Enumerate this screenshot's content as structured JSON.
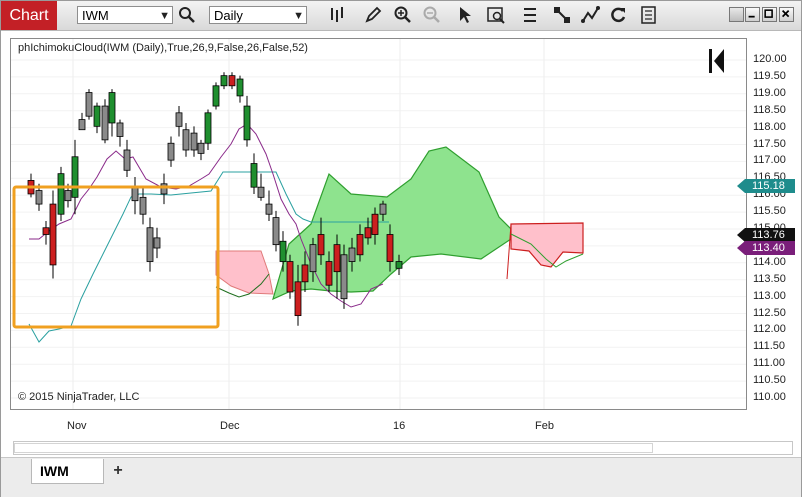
{
  "window": {
    "title": "Chart",
    "instrument": "IWM",
    "interval": "Daily"
  },
  "toolbar": {
    "icons": [
      "search-icon",
      "bar-type-icon",
      "pencil-icon",
      "zoom-in-icon",
      "zoom-out-icon",
      "pointer-icon",
      "data-box-icon",
      "properties-icon",
      "strategy-icon",
      "indicators-icon",
      "reload-icon",
      "template-icon"
    ]
  },
  "chart": {
    "indicator_label": "phIchimokuCloud(IWM (Daily),True,26,9,False,26,False,52)",
    "copyright": "© 2015 NinjaTrader, LLC",
    "y_ticks": [
      "120.00",
      "119.50",
      "119.00",
      "118.50",
      "118.00",
      "117.50",
      "117.00",
      "116.50",
      "116.00",
      "115.50",
      "115.00",
      "114.50",
      "114.00",
      "113.50",
      "113.00",
      "112.50",
      "112.00",
      "111.50",
      "111.00",
      "110.50",
      "110.00"
    ],
    "x_ticks": [
      "Nov",
      "Dec",
      "16",
      "Feb"
    ],
    "price_tags": [
      {
        "value": "115.18",
        "color": "#1e8c8c"
      },
      {
        "value": "113.76",
        "color": "#111111"
      },
      {
        "value": "113.40",
        "color": "#7a1e7a"
      }
    ]
  },
  "colors": {
    "up_candle": "#1f8f2f",
    "down_candle": "#cc1f1f",
    "neutral_candle": "#8a8a8a",
    "cloud_bull": "#8ee38e",
    "cloud_bear": "#ffc0cb",
    "tenkan": "#8a2a8a",
    "kijun": "#2aa0a0",
    "highlight_box": "#f0a020"
  },
  "tabs": [
    {
      "label": "IWM",
      "active": true
    }
  ],
  "tab_add_label": "+"
}
